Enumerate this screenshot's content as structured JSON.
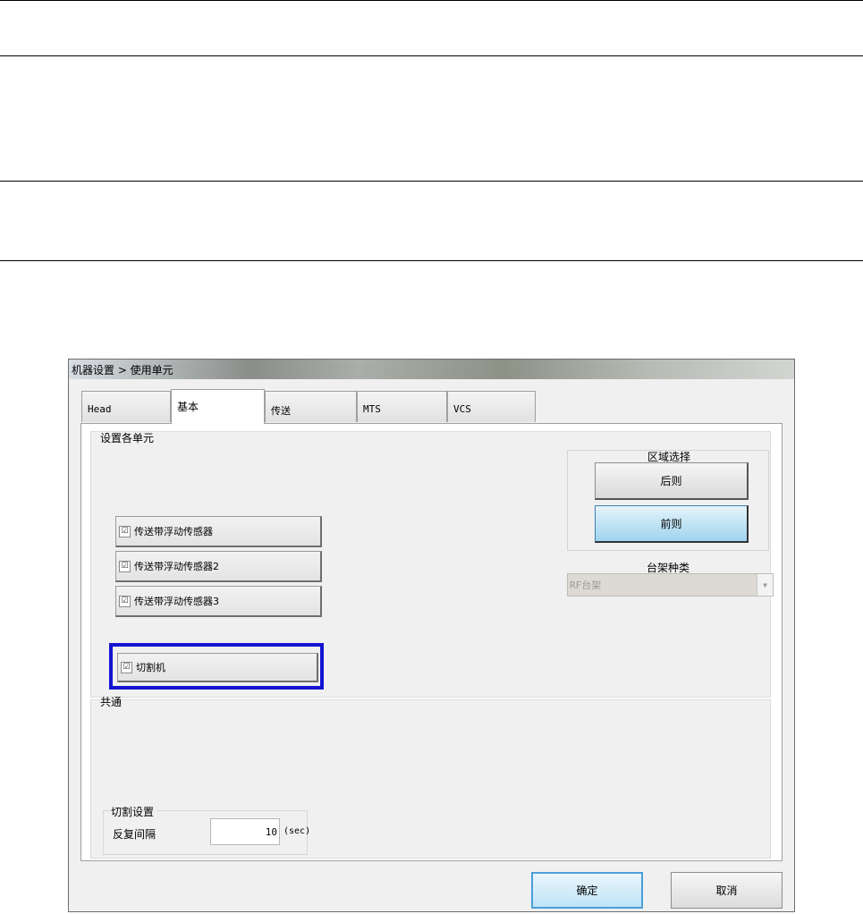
{
  "window": {
    "title": "机器设置 > 使用单元"
  },
  "tabs": [
    {
      "label": "Head",
      "active": false
    },
    {
      "label": "基本",
      "active": true
    },
    {
      "label": "传送",
      "active": false
    },
    {
      "label": "MTS",
      "active": false
    },
    {
      "label": "VCS",
      "active": false
    }
  ],
  "units_group": {
    "title": "设置各单元",
    "checkboxes": [
      {
        "label": "传送带浮动传感器",
        "checked": true
      },
      {
        "label": "传送带浮动传感器2",
        "checked": true
      },
      {
        "label": "传送带浮动传感器3",
        "checked": true
      }
    ],
    "cutter": {
      "label": "切割机",
      "checked": true
    },
    "highlight_color": "#1414d2"
  },
  "area_select": {
    "title": "区域选择",
    "rear_label": "后则",
    "front_label": "前则"
  },
  "rack_type": {
    "label": "台架种类",
    "value": "RF台架"
  },
  "common_group": {
    "title": "共通",
    "cut_settings": {
      "title": "切割设置",
      "repeat_label": "反复间隔",
      "repeat_value": "10",
      "unit": "(sec)"
    }
  },
  "footer": {
    "ok_label": "确定",
    "cancel_label": "取消"
  },
  "check_glyph": "☑"
}
